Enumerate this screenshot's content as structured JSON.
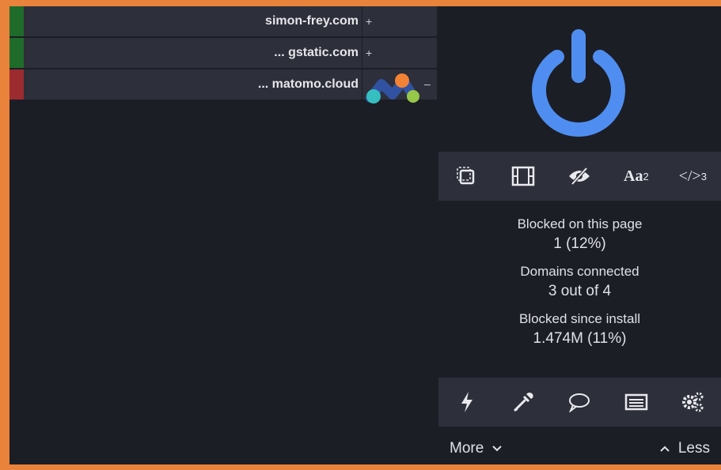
{
  "domains": [
    {
      "name": "simon-frey.com",
      "status_color": "#1f6b2a",
      "toggle": "+"
    },
    {
      "name": "... gstatic.com",
      "status_color": "#1f6b2a",
      "toggle": "+"
    },
    {
      "name": "... matomo.cloud",
      "status_color": "#9b2b2e",
      "toggle": "–"
    }
  ],
  "power": {
    "icon": "power-icon",
    "color": "#4f8ef0"
  },
  "toolbar_top": [
    {
      "icon": "element-picker-icon",
      "label": ""
    },
    {
      "icon": "film-icon",
      "label": ""
    },
    {
      "icon": "eye-slash-icon",
      "label": ""
    },
    {
      "icon": "font-icon",
      "label": "Aa",
      "badge": "2"
    },
    {
      "icon": "code-icon",
      "label": "</>",
      "badge": "3"
    }
  ],
  "stats": {
    "blocked_page_label": "Blocked on this page",
    "blocked_page_value": "1 (12%)",
    "domains_label": "Domains connected",
    "domains_value": "3 out of 4",
    "blocked_install_label": "Blocked since install",
    "blocked_install_value": "1.474M (11%)"
  },
  "toolbar_bottom": [
    "bolt-icon",
    "eyedropper-icon",
    "comment-icon",
    "list-icon",
    "gears-icon"
  ],
  "footer": {
    "more": "More",
    "less": "Less"
  }
}
